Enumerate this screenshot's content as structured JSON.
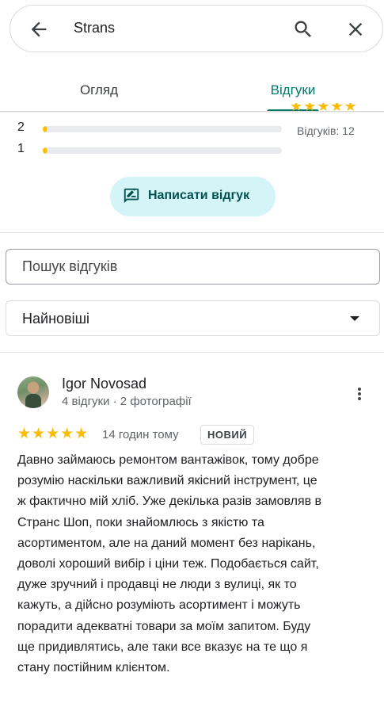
{
  "search": {
    "query": "Strans"
  },
  "tabs": [
    {
      "label": "Огляд",
      "active": false
    },
    {
      "label": "Відгуки",
      "active": true
    }
  ],
  "histogram": [
    {
      "star": "2",
      "fraction": 0.01
    },
    {
      "star": "1",
      "fraction": 0.01
    }
  ],
  "summary": {
    "stars": "★★★★★",
    "count_label": "Відгуків: 12"
  },
  "write_review": {
    "label": "Написати відгук"
  },
  "review_search": {
    "placeholder": "Пошук відгуків"
  },
  "sort": {
    "selected": "Найновіші"
  },
  "review": {
    "author": "Igor Novosad",
    "meta": "4 відгуки · 2 фотографії",
    "stars": "★★★★★",
    "time": "14 годин тому",
    "badge": "НОВИЙ",
    "text": "Давно займаюсь ремонтом вантажівок, тому добре\nрозумію наскільки важливий якісний інструмент, це\nж фактично мій хліб. Уже декілька разів замовляв в\nСтранс Шоп, поки знайомлюсь з якістю та\nасортиментом, але на даний момент без нарікань,\nдоволі хороший вибір і ціни теж. Подобається сайт,\nдуже зручний і продавці не люди з вулиці, як то\nкажуть, а дійсно розуміють асортимент і можуть\nпорадити адекватні товари за моїм запитом. Буду\nще придивлятись, але таки все вказує на те що я\nстану постійним клієнтом."
  },
  "colors": {
    "accent": "#00796b",
    "star": "#fbbc04",
    "button_bg": "#d4f4f7"
  }
}
